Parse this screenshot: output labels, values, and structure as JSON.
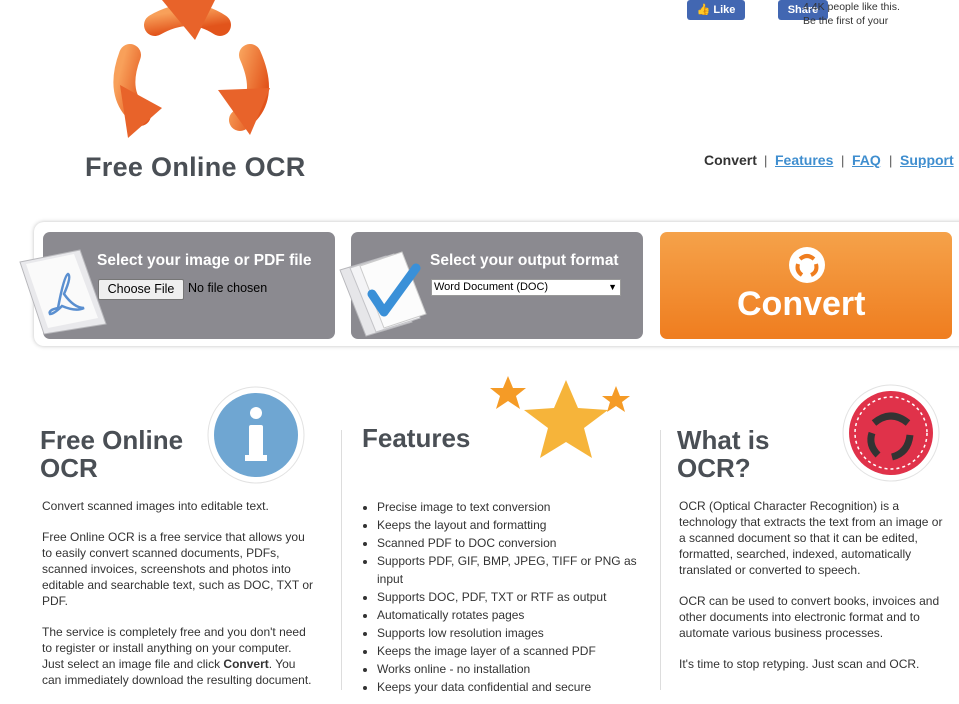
{
  "header": {
    "site_title": "Free Online OCR",
    "social": {
      "like_label": "Like",
      "share_label": "Share",
      "likes_text": "4.4K people like this.",
      "first_text": "Be the first of your"
    },
    "nav": {
      "current": "Convert",
      "separator": "|",
      "links": [
        "Features",
        "FAQ",
        "Support"
      ]
    }
  },
  "converter": {
    "input_label": "Select your image or PDF file",
    "file_button": "Choose File",
    "file_status": "No file chosen",
    "format_label": "Select your output format",
    "format_selected": "Word Document (DOC)",
    "convert_label": "Convert"
  },
  "about": {
    "title_line1": "Free Online",
    "title_line2": "OCR",
    "paragraphs": [
      "Convert scanned images into editable text.",
      "Free Online OCR is a free service that allows you to easily convert scanned documents, PDFs, scanned invoices, screenshots and photos into editable and searchable text, such as DOC, TXT or PDF."
    ],
    "p3_pre": "The service is completely free and you don't need to register or install anything on your computer. Just select an image file and click ",
    "p3_bold": "Convert",
    "p3_post": ". You can immediately download the resulting document."
  },
  "features": {
    "title": "Features",
    "items": [
      "Precise image to text conversion",
      "Keeps the layout and formatting",
      "Scanned PDF to DOC conversion",
      "Supports PDF, GIF, BMP, JPEG, TIFF or PNG as input",
      "Supports DOC, PDF, TXT or RTF as output",
      "Automatically rotates pages",
      "Supports low resolution images",
      "Keeps the image layer of a scanned PDF",
      "Works online - no installation",
      "Keeps your data confidential and secure"
    ]
  },
  "whatis": {
    "title_line1": "What is",
    "title_line2": "OCR?",
    "paragraphs": [
      "OCR (Optical Character Recognition) is a technology that extracts the text from an image or a scanned document so that it can be edited, formatted, searched, indexed, automatically translated or converted to speech.",
      "OCR can be used to convert books, invoices and other documents into electronic format and to automate various business processes.",
      "It's time to stop retyping. Just scan and OCR."
    ]
  },
  "colors": {
    "accent_orange": "#ef7d1f",
    "link_blue": "#3f8ecf",
    "panel_gray": "#8b8a90",
    "facebook_blue": "#4267b2"
  },
  "icons": [
    "recycle-arrows-logo-icon",
    "thumbs-up-icon",
    "pdf-file-icon",
    "checkmark-document-icon",
    "convert-arrows-icon",
    "info-icon",
    "stars-icon",
    "ocr-cycle-icon"
  ]
}
